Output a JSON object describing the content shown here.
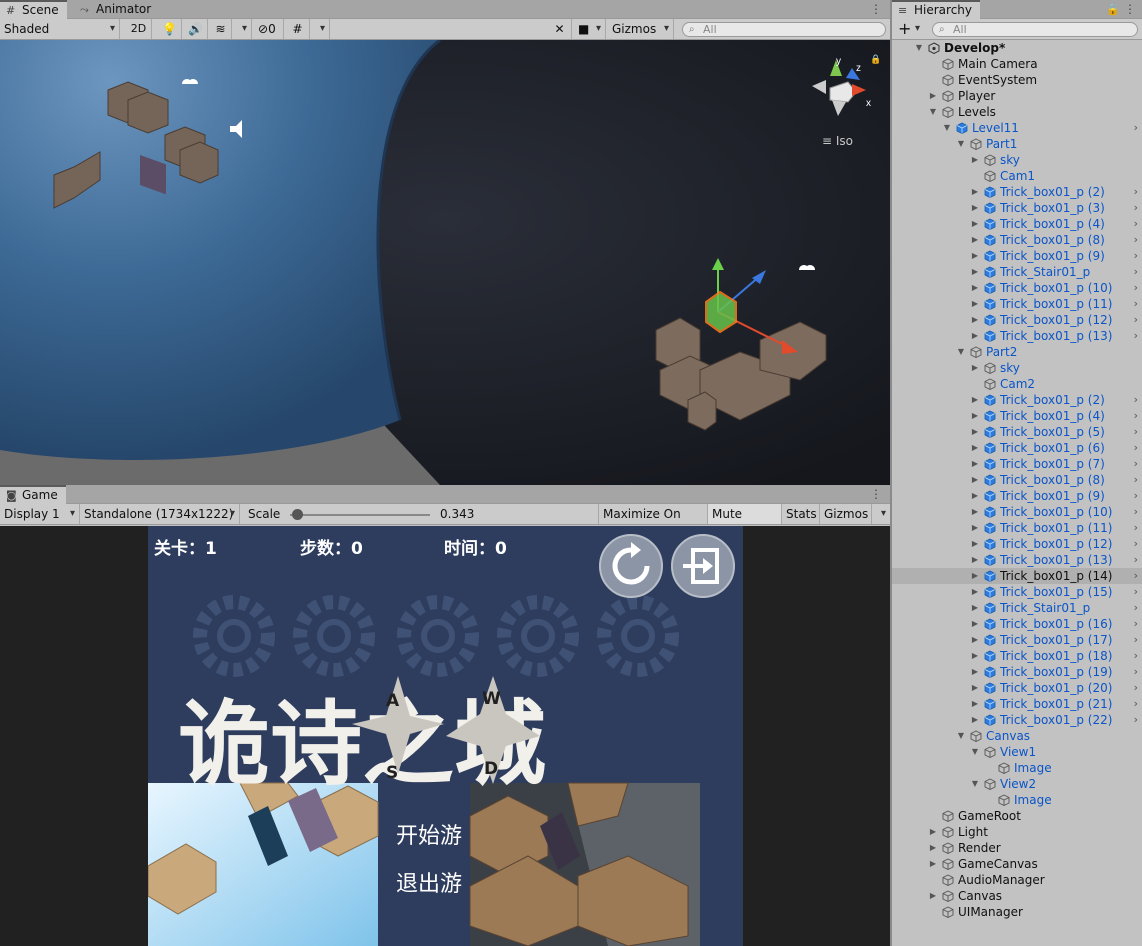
{
  "scene_tabs": [
    {
      "label": "Scene",
      "icon": "grid-icon"
    },
    {
      "label": "Animator",
      "icon": "animator-icon"
    }
  ],
  "scene_toolbar": {
    "shading": "Shaded",
    "mode_2d": "2D",
    "hidden_count": "0",
    "gizmos": "Gizmos",
    "search_placeholder": "All",
    "iso_label": "Iso",
    "axis_x": "x",
    "axis_y": "y",
    "axis_z": "z"
  },
  "game_tab": {
    "label": "Game",
    "icon": "gamepad-icon"
  },
  "game_toolbar": {
    "display": "Display 1",
    "resolution": "Standalone (1734x1222)",
    "scale_label": "Scale",
    "scale_value": "0.343",
    "scale_fraction": 0.05,
    "maximize": "Maximize On Play",
    "mute": "Mute Audio",
    "stats": "Stats",
    "gizmos": "Gizmos"
  },
  "game": {
    "level_label": "关卡：1",
    "steps_label": "步数：0",
    "time_label": "时间：0",
    "title": "诡诗之城",
    "key_a": "A",
    "key_w": "W",
    "key_s": "S",
    "key_d": "D",
    "start": "开始游",
    "quit": "退出游"
  },
  "hierarchy": {
    "tab": "Hierarchy",
    "search_placeholder": "All",
    "rows": [
      {
        "label": "Develop*",
        "depth": 0,
        "arrow": "down",
        "bold": true,
        "icon": "unity"
      },
      {
        "label": "Main Camera",
        "depth": 1,
        "arrow": "",
        "icon": "cube"
      },
      {
        "label": "EventSystem",
        "depth": 1,
        "arrow": "",
        "icon": "cube"
      },
      {
        "label": "Player",
        "depth": 1,
        "arrow": "right",
        "icon": "cube"
      },
      {
        "label": "Levels",
        "depth": 1,
        "arrow": "down",
        "icon": "cube"
      },
      {
        "label": "Level11",
        "depth": 2,
        "arrow": "down",
        "icon": "prefab",
        "blue": true,
        "chev": true
      },
      {
        "label": "Part1",
        "depth": 3,
        "arrow": "down",
        "icon": "cube",
        "blue": true
      },
      {
        "label": "sky",
        "depth": 4,
        "arrow": "right",
        "icon": "cube",
        "blue": true
      },
      {
        "label": "Cam1",
        "depth": 4,
        "arrow": "",
        "icon": "cube",
        "blue": true
      },
      {
        "label": "Trick_box01_p (2)",
        "depth": 4,
        "arrow": "right",
        "icon": "prefab",
        "blue": true,
        "chev": true
      },
      {
        "label": "Trick_box01_p (3)",
        "depth": 4,
        "arrow": "right",
        "icon": "prefab",
        "blue": true,
        "chev": true
      },
      {
        "label": "Trick_box01_p (4)",
        "depth": 4,
        "arrow": "right",
        "icon": "prefab",
        "blue": true,
        "chev": true
      },
      {
        "label": "Trick_box01_p (8)",
        "depth": 4,
        "arrow": "right",
        "icon": "prefab",
        "blue": true,
        "chev": true
      },
      {
        "label": "Trick_box01_p (9)",
        "depth": 4,
        "arrow": "right",
        "icon": "prefab",
        "blue": true,
        "chev": true
      },
      {
        "label": "Trick_Stair01_p",
        "depth": 4,
        "arrow": "right",
        "icon": "prefab",
        "blue": true,
        "chev": true
      },
      {
        "label": "Trick_box01_p (10)",
        "depth": 4,
        "arrow": "right",
        "icon": "prefab",
        "blue": true,
        "chev": true
      },
      {
        "label": "Trick_box01_p (11)",
        "depth": 4,
        "arrow": "right",
        "icon": "prefab",
        "blue": true,
        "chev": true
      },
      {
        "label": "Trick_box01_p (12)",
        "depth": 4,
        "arrow": "right",
        "icon": "prefab",
        "blue": true,
        "chev": true
      },
      {
        "label": "Trick_box01_p (13)",
        "depth": 4,
        "arrow": "right",
        "icon": "prefab",
        "blue": true,
        "chev": true
      },
      {
        "label": "Part2",
        "depth": 3,
        "arrow": "down",
        "icon": "cube",
        "blue": true
      },
      {
        "label": "sky",
        "depth": 4,
        "arrow": "right",
        "icon": "cube",
        "blue": true
      },
      {
        "label": "Cam2",
        "depth": 4,
        "arrow": "",
        "icon": "cube",
        "blue": true
      },
      {
        "label": "Trick_box01_p (2)",
        "depth": 4,
        "arrow": "right",
        "icon": "prefab",
        "blue": true,
        "chev": true
      },
      {
        "label": "Trick_box01_p (4)",
        "depth": 4,
        "arrow": "right",
        "icon": "prefab",
        "blue": true,
        "chev": true
      },
      {
        "label": "Trick_box01_p (5)",
        "depth": 4,
        "arrow": "right",
        "icon": "prefab",
        "blue": true,
        "chev": true
      },
      {
        "label": "Trick_box01_p (6)",
        "depth": 4,
        "arrow": "right",
        "icon": "prefab",
        "blue": true,
        "chev": true
      },
      {
        "label": "Trick_box01_p (7)",
        "depth": 4,
        "arrow": "right",
        "icon": "prefab",
        "blue": true,
        "chev": true
      },
      {
        "label": "Trick_box01_p (8)",
        "depth": 4,
        "arrow": "right",
        "icon": "prefab",
        "blue": true,
        "chev": true
      },
      {
        "label": "Trick_box01_p (9)",
        "depth": 4,
        "arrow": "right",
        "icon": "prefab",
        "blue": true,
        "chev": true
      },
      {
        "label": "Trick_box01_p (10)",
        "depth": 4,
        "arrow": "right",
        "icon": "prefab",
        "blue": true,
        "chev": true
      },
      {
        "label": "Trick_box01_p (11)",
        "depth": 4,
        "arrow": "right",
        "icon": "prefab",
        "blue": true,
        "chev": true
      },
      {
        "label": "Trick_box01_p (12)",
        "depth": 4,
        "arrow": "right",
        "icon": "prefab",
        "blue": true,
        "chev": true
      },
      {
        "label": "Trick_box01_p (13)",
        "depth": 4,
        "arrow": "right",
        "icon": "prefab",
        "blue": true,
        "chev": true
      },
      {
        "label": "Trick_box01_p (14)",
        "depth": 4,
        "arrow": "right",
        "icon": "prefab",
        "blue": false,
        "chev": true,
        "selected": true
      },
      {
        "label": "Trick_box01_p (15)",
        "depth": 4,
        "arrow": "right",
        "icon": "prefab",
        "blue": true,
        "chev": true
      },
      {
        "label": "Trick_Stair01_p",
        "depth": 4,
        "arrow": "right",
        "icon": "prefab",
        "blue": true,
        "chev": true
      },
      {
        "label": "Trick_box01_p (16)",
        "depth": 4,
        "arrow": "right",
        "icon": "prefab",
        "blue": true,
        "chev": true
      },
      {
        "label": "Trick_box01_p (17)",
        "depth": 4,
        "arrow": "right",
        "icon": "prefab",
        "blue": true,
        "chev": true
      },
      {
        "label": "Trick_box01_p (18)",
        "depth": 4,
        "arrow": "right",
        "icon": "prefab",
        "blue": true,
        "chev": true
      },
      {
        "label": "Trick_box01_p (19)",
        "depth": 4,
        "arrow": "right",
        "icon": "prefab",
        "blue": true,
        "chev": true
      },
      {
        "label": "Trick_box01_p (20)",
        "depth": 4,
        "arrow": "right",
        "icon": "prefab",
        "blue": true,
        "chev": true
      },
      {
        "label": "Trick_box01_p (21)",
        "depth": 4,
        "arrow": "right",
        "icon": "prefab",
        "blue": true,
        "chev": true
      },
      {
        "label": "Trick_box01_p (22)",
        "depth": 4,
        "arrow": "right",
        "icon": "prefab",
        "blue": true,
        "chev": true
      },
      {
        "label": "Canvas",
        "depth": 3,
        "arrow": "down",
        "icon": "cube",
        "blue": true
      },
      {
        "label": "View1",
        "depth": 4,
        "arrow": "down",
        "icon": "cube",
        "blue": true
      },
      {
        "label": "Image",
        "depth": 5,
        "arrow": "",
        "icon": "cube",
        "blue": true
      },
      {
        "label": "View2",
        "depth": 4,
        "arrow": "down",
        "icon": "cube",
        "blue": true
      },
      {
        "label": "Image",
        "depth": 5,
        "arrow": "",
        "icon": "cube",
        "blue": true
      },
      {
        "label": "GameRoot",
        "depth": 1,
        "arrow": "",
        "icon": "cube"
      },
      {
        "label": "Light",
        "depth": 1,
        "arrow": "right",
        "icon": "cube"
      },
      {
        "label": "Render",
        "depth": 1,
        "arrow": "right",
        "icon": "cube"
      },
      {
        "label": "GameCanvas",
        "depth": 1,
        "arrow": "right",
        "icon": "cube"
      },
      {
        "label": "AudioManager",
        "depth": 1,
        "arrow": "",
        "icon": "cube"
      },
      {
        "label": "Canvas",
        "depth": 1,
        "arrow": "right",
        "icon": "cube"
      },
      {
        "label": "UIManager",
        "depth": 1,
        "arrow": "",
        "icon": "cube"
      }
    ]
  },
  "colors": {
    "accent_blue": "#0a55c8",
    "panel": "#c2c2c2",
    "toolbar": "#cbcbcb",
    "space": "#1c1f27",
    "planet": "#3a6c9c",
    "game_bg": "#2b3a5a"
  }
}
